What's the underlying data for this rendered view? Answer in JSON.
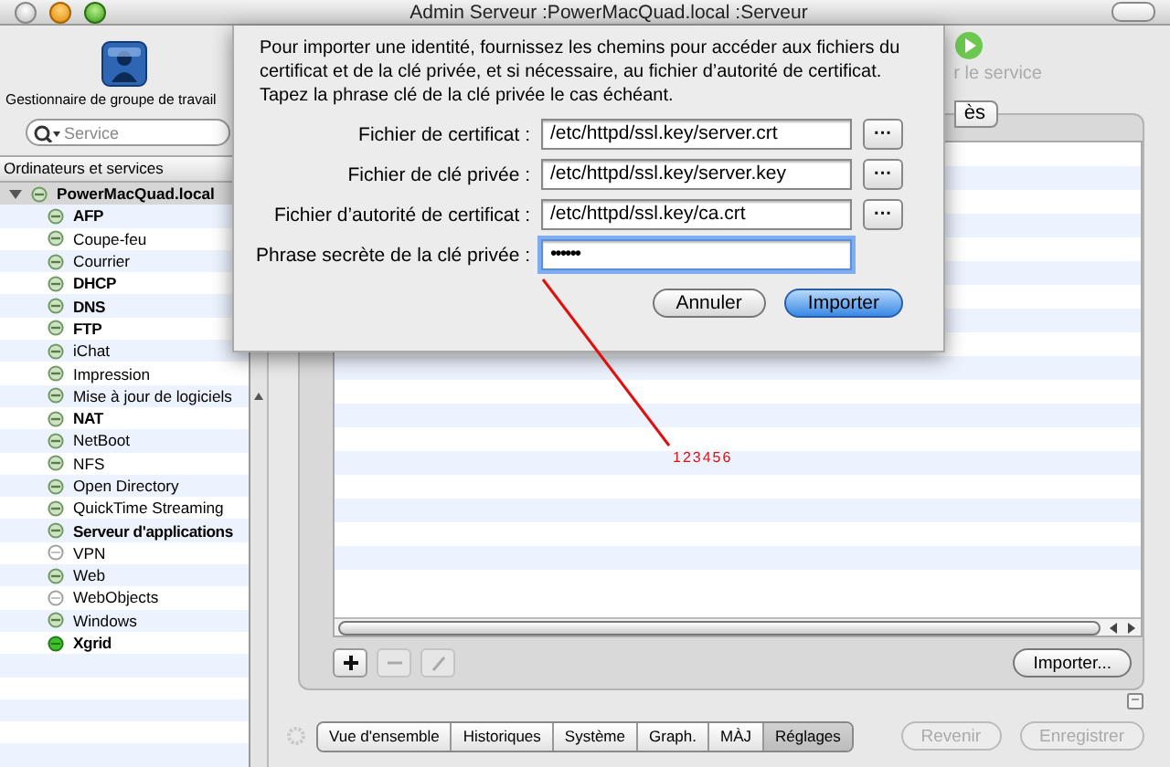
{
  "window": {
    "title": "Admin Serveur :PowerMacQuad.local :Serveur"
  },
  "sidebar": {
    "toolbar_label": "Gestionnaire de groupe de travail",
    "search": {
      "placeholder": "Service"
    },
    "header": "Ordinateurs et services",
    "tree": [
      {
        "label": "PowerMacQuad.local",
        "expanded": true,
        "bold": true,
        "kind": "idle",
        "children": [
          {
            "label": "AFP",
            "bold": true,
            "kind": "idle"
          },
          {
            "label": "Coupe-feu",
            "bold": false,
            "kind": "idle"
          },
          {
            "label": "Courrier",
            "bold": false,
            "kind": "idle"
          },
          {
            "label": "DHCP",
            "bold": true,
            "kind": "idle"
          },
          {
            "label": "DNS",
            "bold": true,
            "kind": "idle"
          },
          {
            "label": "FTP",
            "bold": true,
            "kind": "idle"
          },
          {
            "label": "iChat",
            "bold": false,
            "kind": "idle"
          },
          {
            "label": "Impression",
            "bold": false,
            "kind": "idle"
          },
          {
            "label": "Mise à jour de logiciels",
            "bold": false,
            "kind": "idle"
          },
          {
            "label": "NAT",
            "bold": true,
            "kind": "idle"
          },
          {
            "label": "NetBoot",
            "bold": false,
            "kind": "idle"
          },
          {
            "label": "NFS",
            "bold": false,
            "kind": "idle"
          },
          {
            "label": "Open Directory",
            "bold": false,
            "kind": "idle"
          },
          {
            "label": "QuickTime Streaming",
            "bold": false,
            "kind": "idle"
          },
          {
            "label": "Serveur d'applications",
            "bold": true,
            "kind": "idle"
          },
          {
            "label": "VPN",
            "bold": false,
            "kind": "off"
          },
          {
            "label": "Web",
            "bold": false,
            "kind": "idle"
          },
          {
            "label": "WebObjects",
            "bold": false,
            "kind": "off"
          },
          {
            "label": "Windows",
            "bold": false,
            "kind": "idle"
          },
          {
            "label": "Xgrid",
            "bold": true,
            "kind": "running"
          }
        ]
      }
    ]
  },
  "toolbar": {
    "start_label": "r le service"
  },
  "tabs": [
    {
      "label": "ès",
      "selected": false
    }
  ],
  "table_buttons": [
    {
      "kind": "add",
      "disabled": false
    },
    {
      "kind": "remove",
      "disabled": true
    },
    {
      "kind": "edit",
      "disabled": true
    }
  ],
  "import_button": {
    "label": "Importer..."
  },
  "bottom_tabs": [
    {
      "label": "Vue d'ensemble",
      "selected": false
    },
    {
      "label": "Historiques",
      "selected": false
    },
    {
      "label": "Système",
      "selected": false
    },
    {
      "label": "Graph.",
      "selected": false
    },
    {
      "label": "MÀJ",
      "selected": false
    },
    {
      "label": "Réglages",
      "selected": true
    }
  ],
  "bottom_buttons": [
    {
      "label": "Revenir",
      "disabled": true
    },
    {
      "label": "Enregistrer",
      "disabled": true
    }
  ],
  "sheet": {
    "message": "Pour importer une identité, fournissez les chemins pour accéder aux fichiers du certificat et de la clé privée, et si nécessaire, au fichier d’autorité de certificat. Tapez la phrase clé de la clé privée le cas échéant.",
    "fields": [
      {
        "kind": "file",
        "label": "Fichier de certificat :",
        "value": "/etc/httpd/ssl.key/server.crt",
        "browse": "···"
      },
      {
        "kind": "file",
        "label": "Fichier de clé privée :",
        "value": "/etc/httpd/ssl.key/server.key",
        "browse": "···"
      },
      {
        "kind": "file",
        "label": "Fichier d’autorité de certificat :",
        "value": "/etc/httpd/ssl.key/ca.crt",
        "browse": "···"
      },
      {
        "kind": "password",
        "label": "Phrase secrète de la clé privée :",
        "value": "••••••"
      }
    ],
    "buttons": [
      {
        "label": "Annuler",
        "default": false
      },
      {
        "label": "Importer",
        "default": true
      }
    ]
  },
  "annotation": {
    "text": "123456"
  }
}
